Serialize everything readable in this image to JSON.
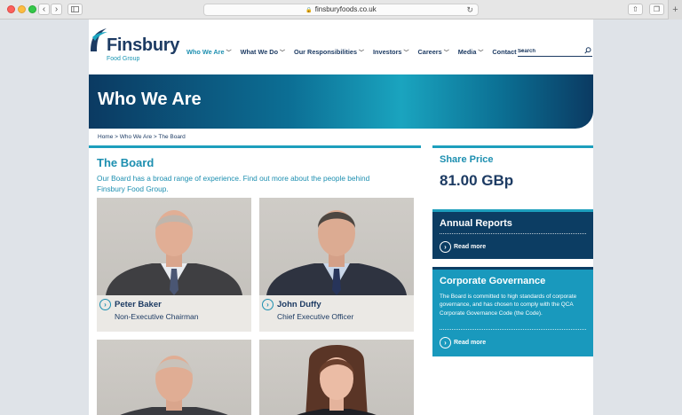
{
  "browser": {
    "url": "finsburyfoods.co.uk",
    "back_icon": "chevron-left-icon",
    "forward_icon": "chevron-right-icon"
  },
  "logo": {
    "name": "Finsbury",
    "sub": "Food Group"
  },
  "nav": {
    "items": [
      {
        "label": "Who We Are",
        "active": true
      },
      {
        "label": "What We Do"
      },
      {
        "label": "Our Responsibilities"
      },
      {
        "label": "Investors"
      },
      {
        "label": "Careers"
      },
      {
        "label": "Media"
      },
      {
        "label": "Contact"
      }
    ],
    "search_placeholder": "Search"
  },
  "hero": {
    "title": "Who We Are"
  },
  "breadcrumb": "Home > Who We Are > The Board",
  "board": {
    "title": "The Board",
    "description": "Our Board has a broad range of experience. Find out more about the people behind Finsbury Food Group.",
    "members": [
      {
        "name": "Peter Baker",
        "role": "Non-Executive Chairman"
      },
      {
        "name": "John Duffy",
        "role": "Chief Executive Officer"
      },
      {
        "name": "",
        "role": ""
      },
      {
        "name": "",
        "role": ""
      }
    ]
  },
  "sidebar": {
    "share_title": "Share Price",
    "share_value": "81.00 GBp",
    "annual_title": "Annual Reports",
    "annual_link": "Read more",
    "gov_title": "Corporate Governance",
    "gov_text": "The Board is committed to high standards of corporate governance, and has chosen to comply with the QCA Corporate Governance Code (the Code).",
    "gov_link": "Read more"
  },
  "colors": {
    "navy": "#1d3b63",
    "teal": "#1d8fb0",
    "panel_dark": "#0c3d63",
    "panel_teal": "#1999bd"
  }
}
